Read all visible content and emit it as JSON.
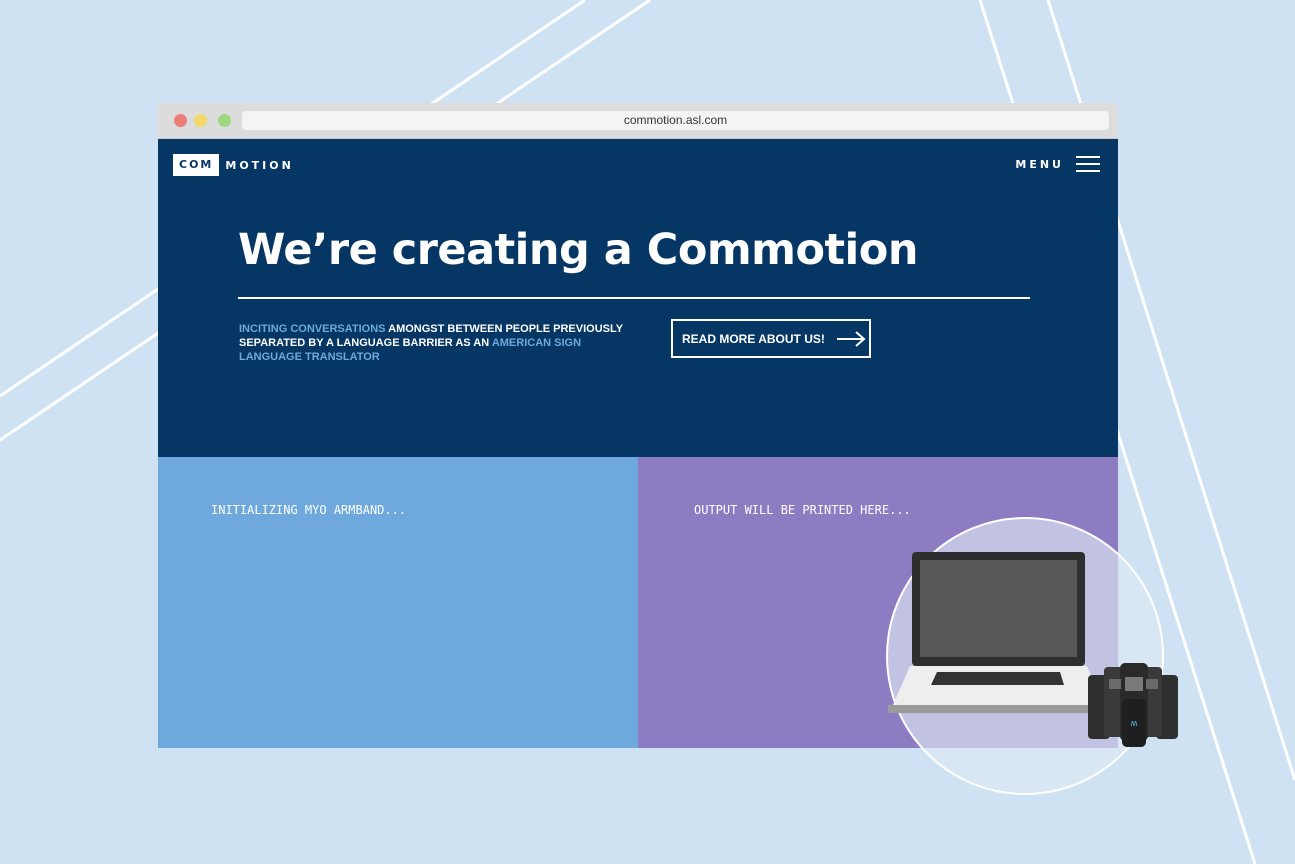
{
  "browser": {
    "url": "commotion.asl.com"
  },
  "header": {
    "logo_boxed": "COM",
    "logo_rest": "MOTION",
    "menu_label": "MENU"
  },
  "hero": {
    "headline": "We’re creating a Commotion",
    "tagline_parts": {
      "highlight_1": "INCITING CONVERSATIONS",
      "text_1": " AMONGST BETWEEN PEOPLE PREVIOUSLY SEPARATED BY A LANGUAGE BARRIER AS AN ",
      "highlight_2": "AMERICAN SIGN LANGUAGE TRANSLATOR"
    },
    "cta_label": "READ MORE ABOUT US!"
  },
  "panels": {
    "input_status": "INITIALIZING MYO ARMBAND...",
    "output_status": "OUTPUT WILL BE PRINTED HERE..."
  },
  "icons": {
    "cta_icon": "arrow-right-icon",
    "menu_icon": "hamburger-icon"
  },
  "colors": {
    "background": "#cfe2f3",
    "hero": "#063663",
    "highlight": "#6fa8dc",
    "input_panel": "#6fa8dc",
    "output_panel": "#8e7cc3"
  }
}
